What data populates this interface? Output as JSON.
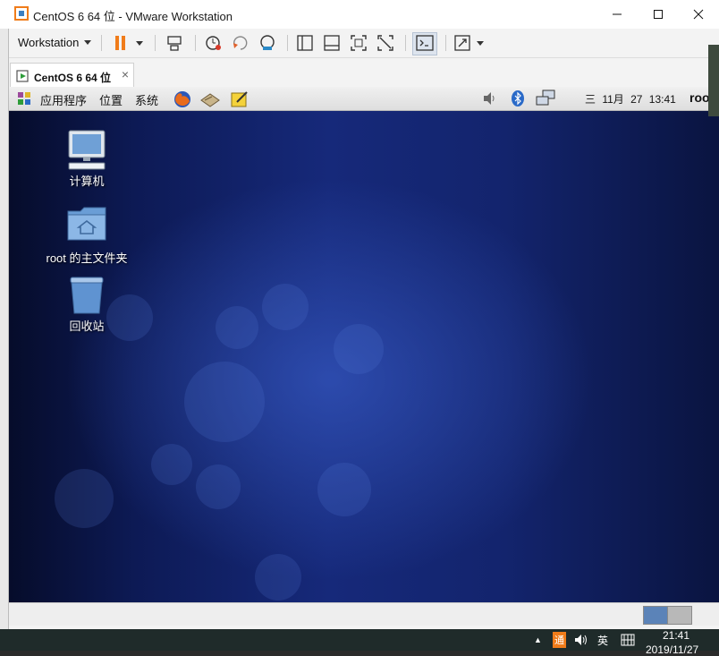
{
  "window": {
    "title": "CentOS 6 64 位 - VMware Workstation"
  },
  "toolbar": {
    "workstation_menu": "Workstation"
  },
  "tabs": [
    {
      "label": "CentOS 6 64 位"
    }
  ],
  "guest_panel": {
    "menus": [
      "应用程序",
      "位置",
      "系统"
    ],
    "clock": "三 11月 27 13:41",
    "user": "root"
  },
  "desktop_icons": [
    {
      "label": "计算机",
      "icon": "computer-icon"
    },
    {
      "label": "root 的主文件夹",
      "icon": "home-folder-icon"
    },
    {
      "label": "回收站",
      "icon": "trash-icon"
    }
  ],
  "host_taskbar": {
    "ime_label": "通",
    "lang": "英",
    "time": "21:41",
    "date_partial": "2019/11/27"
  },
  "colors": {
    "accent_orange": "#f07c1a",
    "desktop_blue": "#16297a"
  }
}
